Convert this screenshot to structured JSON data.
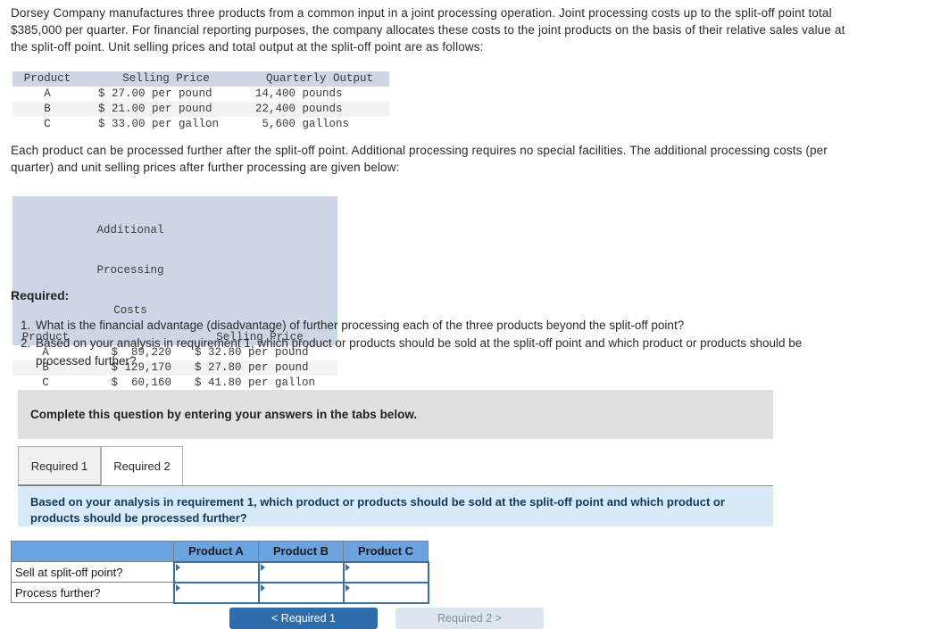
{
  "intro_paragraph": "Dorsey Company manufactures three products from a common input in a joint processing operation. Joint processing costs up to the split-off point total $385,000 per quarter. For financial reporting purposes, the company allocates these costs to the joint products on the basis of their relative sales value at the split-off point. Unit selling prices and total output at the split-off point are as follows:",
  "further_paragraph": "Each product can be processed further after the split-off point. Additional processing requires no special facilities. The additional processing costs (per quarter) and unit selling prices after further processing are given below:",
  "split_off_table": {
    "headers": [
      "Product",
      "Selling Price",
      "Quarterly Output"
    ],
    "rows": [
      {
        "product": "A",
        "selling_price": "$ 27.00 per pound",
        "quarterly_output": "14,400 pounds"
      },
      {
        "product": "B",
        "selling_price": "$ 21.00 per pound",
        "quarterly_output": "22,400 pounds"
      },
      {
        "product": "C",
        "selling_price": "$ 33.00 per gallon",
        "quarterly_output": " 5,600 gallons"
      }
    ]
  },
  "further_table": {
    "headers": {
      "product": "Product",
      "cost_line1": "Additional",
      "cost_line2": "Processing",
      "cost_line3": "Costs",
      "selling_price": "Selling Price"
    },
    "rows": [
      {
        "product": "A",
        "cost": "$  89,220",
        "selling_price": "$ 32.80 per pound"
      },
      {
        "product": "B",
        "cost": "$ 129,170",
        "selling_price": "$ 27.80 per pound"
      },
      {
        "product": "C",
        "cost": "$  60,160",
        "selling_price": "$ 41.80 per gallon"
      }
    ]
  },
  "required": {
    "heading": "Required:",
    "items": [
      "What is the financial advantage (disadvantage) of further processing each of the three products beyond the split-off point?",
      "Based on your analysis in requirement 1, which product or products should be sold at the split-off point and which product or products should be processed further?"
    ]
  },
  "instruction_banner": "Complete this question by entering your answers in the tabs below.",
  "tabs": [
    {
      "label": "Required 1",
      "active": false
    },
    {
      "label": "Required 2",
      "active": true
    }
  ],
  "question_box": "Based on your analysis in requirement 1, which product or products should be sold at the split-off point and which product or products should be processed further?",
  "answer_table": {
    "corner_label": "",
    "column_headers": [
      "Product A",
      "Product B",
      "Product C"
    ],
    "rows": [
      {
        "label": "Sell at split-off point?",
        "values": [
          "",
          "",
          ""
        ]
      },
      {
        "label": "Process further?",
        "values": [
          "",
          "",
          ""
        ]
      }
    ]
  },
  "buttons": {
    "previous": "< Required 1",
    "next": "Required 2 >"
  },
  "colors": {
    "table_header_bg": "#ccd6e6",
    "answer_header_bg": "#6ba3e0",
    "question_box_bg": "#d9eaf7",
    "banner_bg": "#e0e0e0",
    "primary_button_bg": "#2e6cad",
    "secondary_button_bg": "#dbe5f0",
    "dropdown_marker": "#3d6fa5"
  }
}
